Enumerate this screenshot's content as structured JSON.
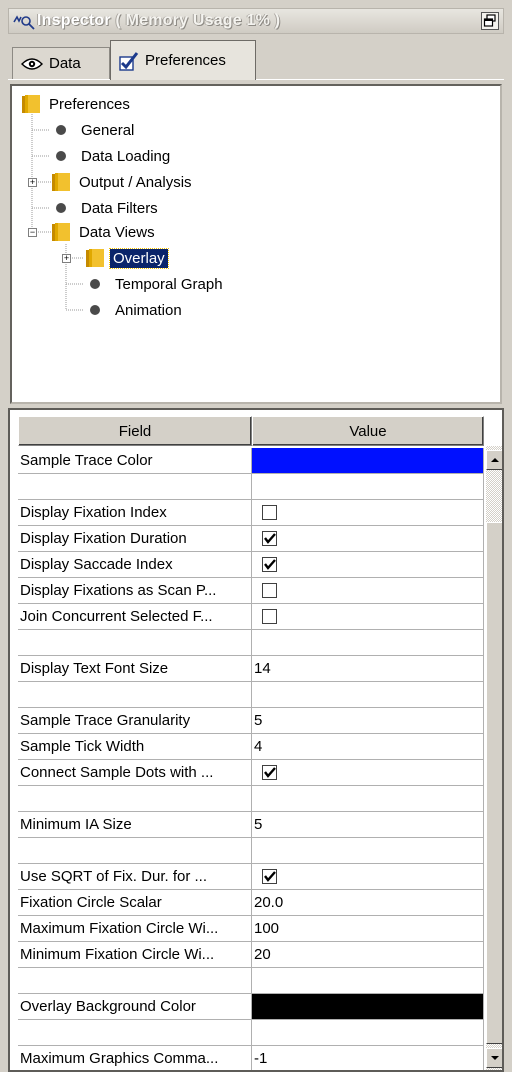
{
  "window": {
    "title": "Inspector",
    "memory": "( Memory Usage 1% )"
  },
  "tabs": [
    {
      "label": "Data",
      "icon": "eye-icon"
    },
    {
      "label": "Preferences",
      "icon": "checkmark-icon",
      "active": true
    }
  ],
  "tree": {
    "root": "Preferences",
    "items": [
      {
        "label": "General",
        "type": "leaf"
      },
      {
        "label": "Data Loading",
        "type": "leaf"
      },
      {
        "label": "Output / Analysis",
        "type": "folder",
        "expanded": false
      },
      {
        "label": "Data Filters",
        "type": "leaf"
      },
      {
        "label": "Data Views",
        "type": "folder",
        "expanded": true
      },
      {
        "label": "Overlay",
        "type": "folder",
        "expanded": false,
        "selected": true
      },
      {
        "label": "Temporal Graph",
        "type": "leaf"
      },
      {
        "label": "Animation",
        "type": "leaf"
      }
    ]
  },
  "grid": {
    "headers": {
      "field": "Field",
      "value": "Value"
    },
    "rows": [
      {
        "field": "Sample Trace Color",
        "kind": "color",
        "value": "#0010ff"
      },
      {
        "field": "",
        "kind": "blank",
        "value": ""
      },
      {
        "field": "Display Fixation Index",
        "kind": "check",
        "value": false
      },
      {
        "field": "Display Fixation Duration",
        "kind": "check",
        "value": true
      },
      {
        "field": "Display Saccade Index",
        "kind": "check",
        "value": true
      },
      {
        "field": "Display Fixations as Scan P...",
        "kind": "check",
        "value": false
      },
      {
        "field": "Join Concurrent Selected F...",
        "kind": "check",
        "value": false
      },
      {
        "field": "",
        "kind": "blank",
        "value": ""
      },
      {
        "field": "Display Text Font Size",
        "kind": "text",
        "value": "14"
      },
      {
        "field": "",
        "kind": "blank",
        "value": ""
      },
      {
        "field": "Sample Trace Granularity",
        "kind": "text",
        "value": "5"
      },
      {
        "field": "Sample Tick Width",
        "kind": "text",
        "value": "4"
      },
      {
        "field": "Connect Sample Dots with ...",
        "kind": "check",
        "value": true
      },
      {
        "field": "",
        "kind": "blank",
        "value": ""
      },
      {
        "field": "Minimum IA Size",
        "kind": "text",
        "value": "5"
      },
      {
        "field": "",
        "kind": "blank",
        "value": ""
      },
      {
        "field": "Use SQRT of Fix. Dur. for ...",
        "kind": "check",
        "value": true
      },
      {
        "field": "Fixation Circle Scalar",
        "kind": "text",
        "value": "20.0"
      },
      {
        "field": "Maximum Fixation Circle Wi...",
        "kind": "text",
        "value": "100"
      },
      {
        "field": "Minimum Fixation Circle Wi...",
        "kind": "text",
        "value": "20"
      },
      {
        "field": "",
        "kind": "blank",
        "value": ""
      },
      {
        "field": "Overlay Background Color",
        "kind": "color",
        "value": "#000000"
      },
      {
        "field": "",
        "kind": "blank",
        "value": ""
      },
      {
        "field": "Maximum Graphics Comma...",
        "kind": "text",
        "value": "-1"
      }
    ]
  },
  "colors": {
    "selection": "#0a246a",
    "chrome": "#d4d0c8"
  }
}
